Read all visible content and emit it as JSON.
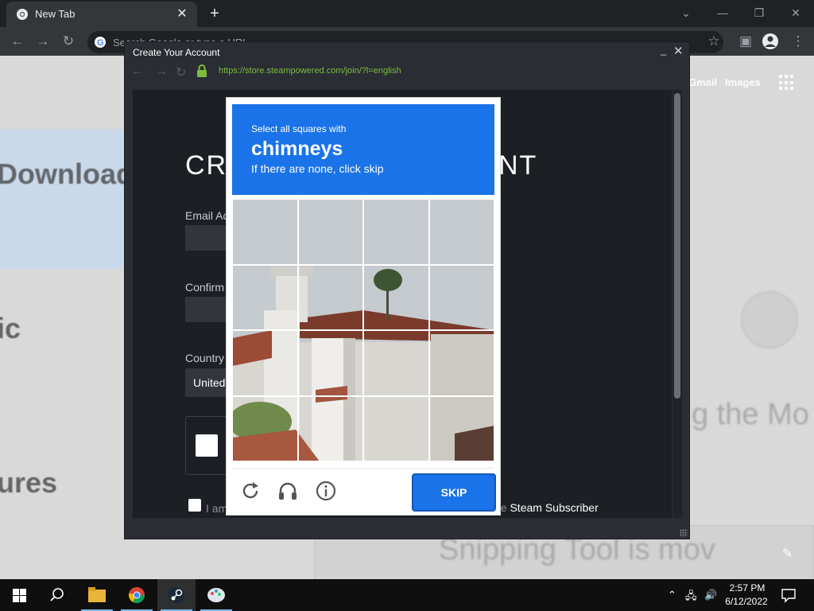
{
  "browser": {
    "tab_title": "New Tab",
    "tab_close": "✕",
    "new_tab": "+",
    "omnibox_placeholder": "Search Google or type a URL",
    "window_controls": [
      "⌄",
      "—",
      "❐",
      "✕"
    ]
  },
  "new_tab_page": {
    "gmail": "Gmail",
    "images": "Images",
    "shortcut_downloads": "Downloads",
    "shortcut_ic": "ic",
    "shortcut_ures": "ures",
    "faint_text_1": "g the Mo",
    "faint_text_2": "Snipping Tool is mov"
  },
  "steam_window": {
    "title": "Create Your Account",
    "minimize": "_",
    "close": "✕",
    "url": "https://store.steampowered.com/join/?l=english",
    "heading_left": "CRI",
    "heading_right": "NT",
    "email_label": "Email Ac",
    "confirm_label": "Confirm",
    "country_label": "Country",
    "country_value": "United",
    "agree_prefix": "I am",
    "agree_suffix": "he",
    "agree_link": "Steam Subscriber"
  },
  "captcha": {
    "prompt": "Select all squares with",
    "target": "chimneys",
    "hint": "If there are none, click skip",
    "skip_label": "SKIP",
    "accent": "#1a73e8"
  },
  "taskbar": {
    "time": "2:57 PM",
    "date": "6/12/2022"
  }
}
